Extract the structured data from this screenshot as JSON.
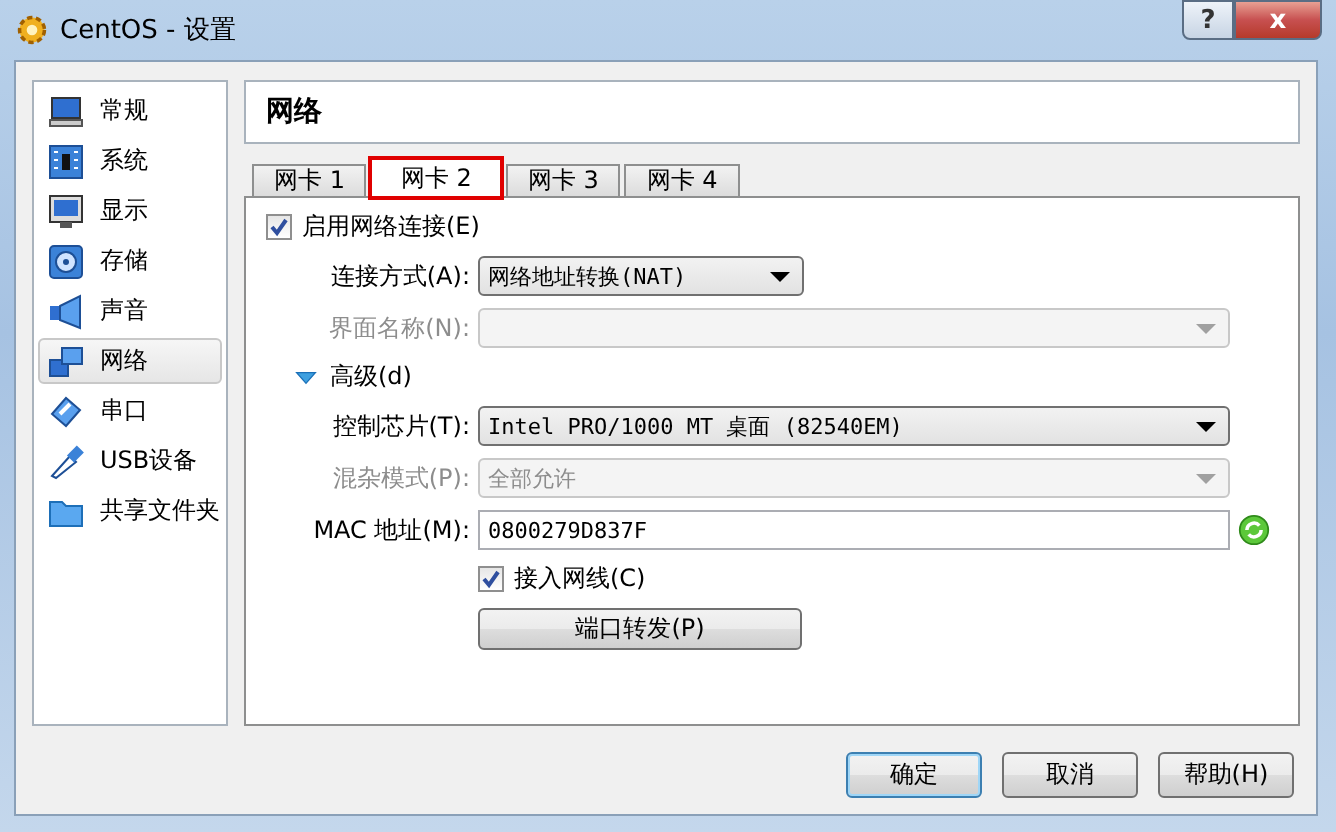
{
  "window": {
    "title": "CentOS - 设置",
    "controls": [
      "?",
      "x"
    ]
  },
  "sidebar": {
    "items": [
      {
        "label": "常规",
        "selected": false
      },
      {
        "label": "系统",
        "selected": false
      },
      {
        "label": "显示",
        "selected": false
      },
      {
        "label": "存储",
        "selected": false
      },
      {
        "label": "声音",
        "selected": false
      },
      {
        "label": "网络",
        "selected": true
      },
      {
        "label": "串口",
        "selected": false
      },
      {
        "label": "USB设备",
        "selected": false
      },
      {
        "label": "共享文件夹",
        "selected": false
      }
    ]
  },
  "section_title": "网络",
  "tabs": [
    {
      "label": "网卡 1",
      "selected": false,
      "highlighted": false
    },
    {
      "label": "网卡 2",
      "selected": true,
      "highlighted": true
    },
    {
      "label": "网卡 3",
      "selected": false,
      "highlighted": false
    },
    {
      "label": "网卡 4",
      "selected": false,
      "highlighted": false
    }
  ],
  "rows": [
    {
      "kind": "checkbox",
      "label": "启用网络连接(E)",
      "checked": true
    },
    {
      "kind": "combo",
      "label": "连接方式(A):",
      "value": "网络地址转换(NAT)",
      "disabled": false
    },
    {
      "kind": "combo",
      "label": "界面名称(N):",
      "disabled": true
    },
    {
      "kind": "expander",
      "label": "高级(d)",
      "expanded": true
    },
    {
      "kind": "combo",
      "label": "控制芯片(T):",
      "value": "Intel PRO/1000 MT 桌面 (82540EM)",
      "disabled": false
    },
    {
      "kind": "combo",
      "label": "混杂模式(P):",
      "value": "全部允许",
      "disabled": true
    },
    {
      "kind": "text",
      "label": "MAC 地址(M):",
      "value": "0800279D837F"
    },
    {
      "kind": "checkbox",
      "label": "接入网线(C)",
      "checked": true
    },
    {
      "kind": "button",
      "label": "端口转发(P)"
    }
  ],
  "buttons": [
    {
      "label": "确定",
      "default": true
    },
    {
      "label": "取消",
      "default": false
    },
    {
      "label": "帮助(H)",
      "default": false
    }
  ]
}
